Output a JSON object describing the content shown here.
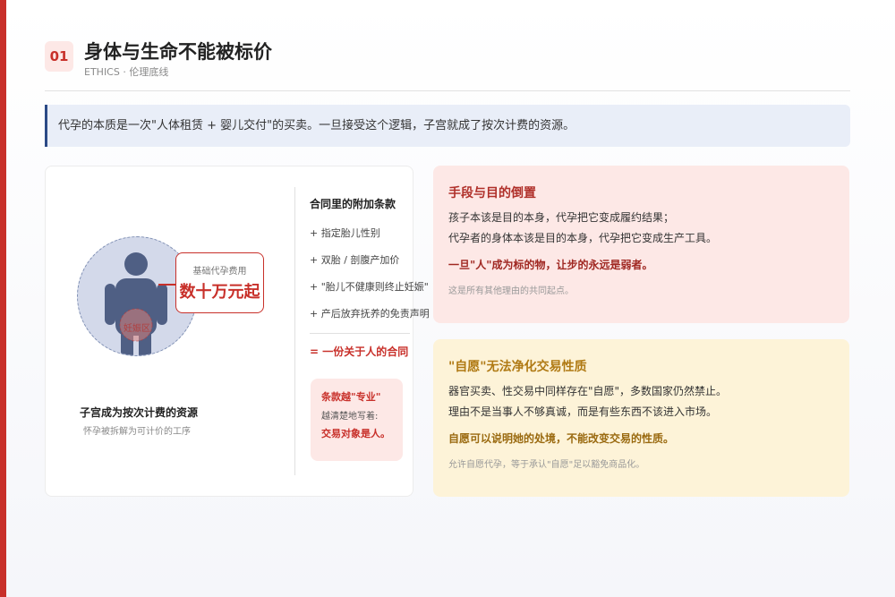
{
  "header": {
    "number": "01",
    "title": "身体与生命不能被标价",
    "subtitle": "ETHICS · 伦理底线"
  },
  "summary": "代孕的本质是一次\"人体租赁 + 婴儿交付\"的买卖。一旦接受这个逻辑，子宫就成了按次计费的资源。",
  "figure": {
    "womb_label": "妊娠区",
    "price_label": "基础代孕费用",
    "price_value": "数十万元起",
    "caption": "子宫成为按次计费的资源",
    "subcaption": "怀孕被拆解为可计价的工序"
  },
  "contract": {
    "title": "合同里的附加条款",
    "clauses": [
      "+ 指定胎儿性别",
      "+ 双胎 / 剖腹产加价",
      "+ \"胎儿不健康则终止妊娠\"",
      "+ 产后放弃抚养的免责声明"
    ],
    "equation": "= 一份关于人的合同",
    "note": {
      "title": "条款越\"专业\"",
      "line": "越清楚地写着:",
      "strong": "交易对象是人。"
    }
  },
  "cards": {
    "red": {
      "title": "手段与目的倒置",
      "lines": [
        "孩子本该是目的本身，代孕把它变成履约结果；",
        "代孕者的身体本该是目的本身，代孕把它变成生产工具。"
      ],
      "emphasis": "一旦\"人\"成为标的物，让步的永远是弱者。",
      "footnote": "这是所有其他理由的共同起点。"
    },
    "yellow": {
      "title": "\"自愿\"无法净化交易性质",
      "lines": [
        "器官买卖、性交易中同样存在\"自愿\"，多数国家仍然禁止。",
        "理由不是当事人不够真诚，而是有些东西不该进入市场。"
      ],
      "emphasis": "自愿可以说明她的处境，不能改变交易的性质。",
      "footnote": "允许自愿代孕，等于承认\"自愿\"足以豁免商品化。"
    }
  },
  "colors": {
    "accent_red": "#c8302a",
    "accent_navy": "#2b4a86",
    "card_red_bg": "#fde8e6",
    "card_yellow_bg": "#fdf3d8",
    "figure_fill": "#4f5f84"
  }
}
